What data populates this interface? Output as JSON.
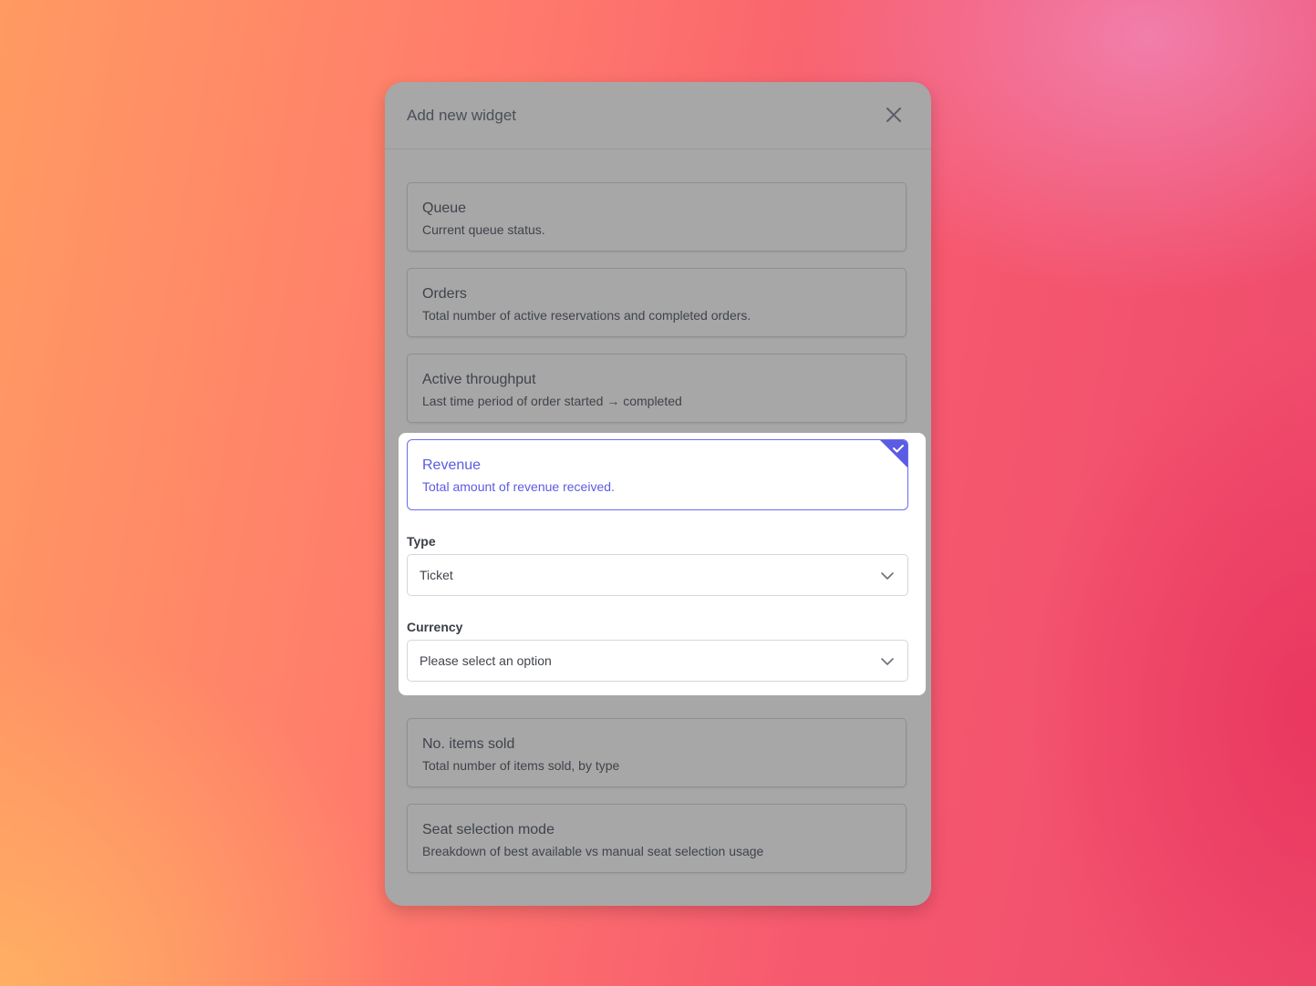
{
  "modal": {
    "title": "Add new widget",
    "close_icon": "close-icon"
  },
  "widgets": [
    {
      "title": "Queue",
      "description": "Current queue status."
    },
    {
      "title": "Orders",
      "description": "Total number of active reservations and completed orders."
    },
    {
      "title": "Active throughput",
      "description": "Last time period of order started → completed"
    },
    {
      "title": "Revenue",
      "description": "Total amount of revenue received.",
      "selected": true
    },
    {
      "title": "No. items sold",
      "description": "Total number of items sold, by type"
    },
    {
      "title": "Seat selection mode",
      "description": "Breakdown of best available vs manual seat selection usage"
    }
  ],
  "revenue_options": {
    "type_label": "Type",
    "type_value": "Ticket",
    "currency_label": "Currency",
    "currency_placeholder": "Please select an option"
  },
  "colors": {
    "accent": "#5b5be3",
    "overlay": "#a7a7a7",
    "background_start": "#ff9a62",
    "background_end": "#ee4a6c"
  },
  "icons": {
    "close": "close-icon",
    "selected": "checkmark-icon",
    "dropdown": "chevron-down-icon"
  }
}
